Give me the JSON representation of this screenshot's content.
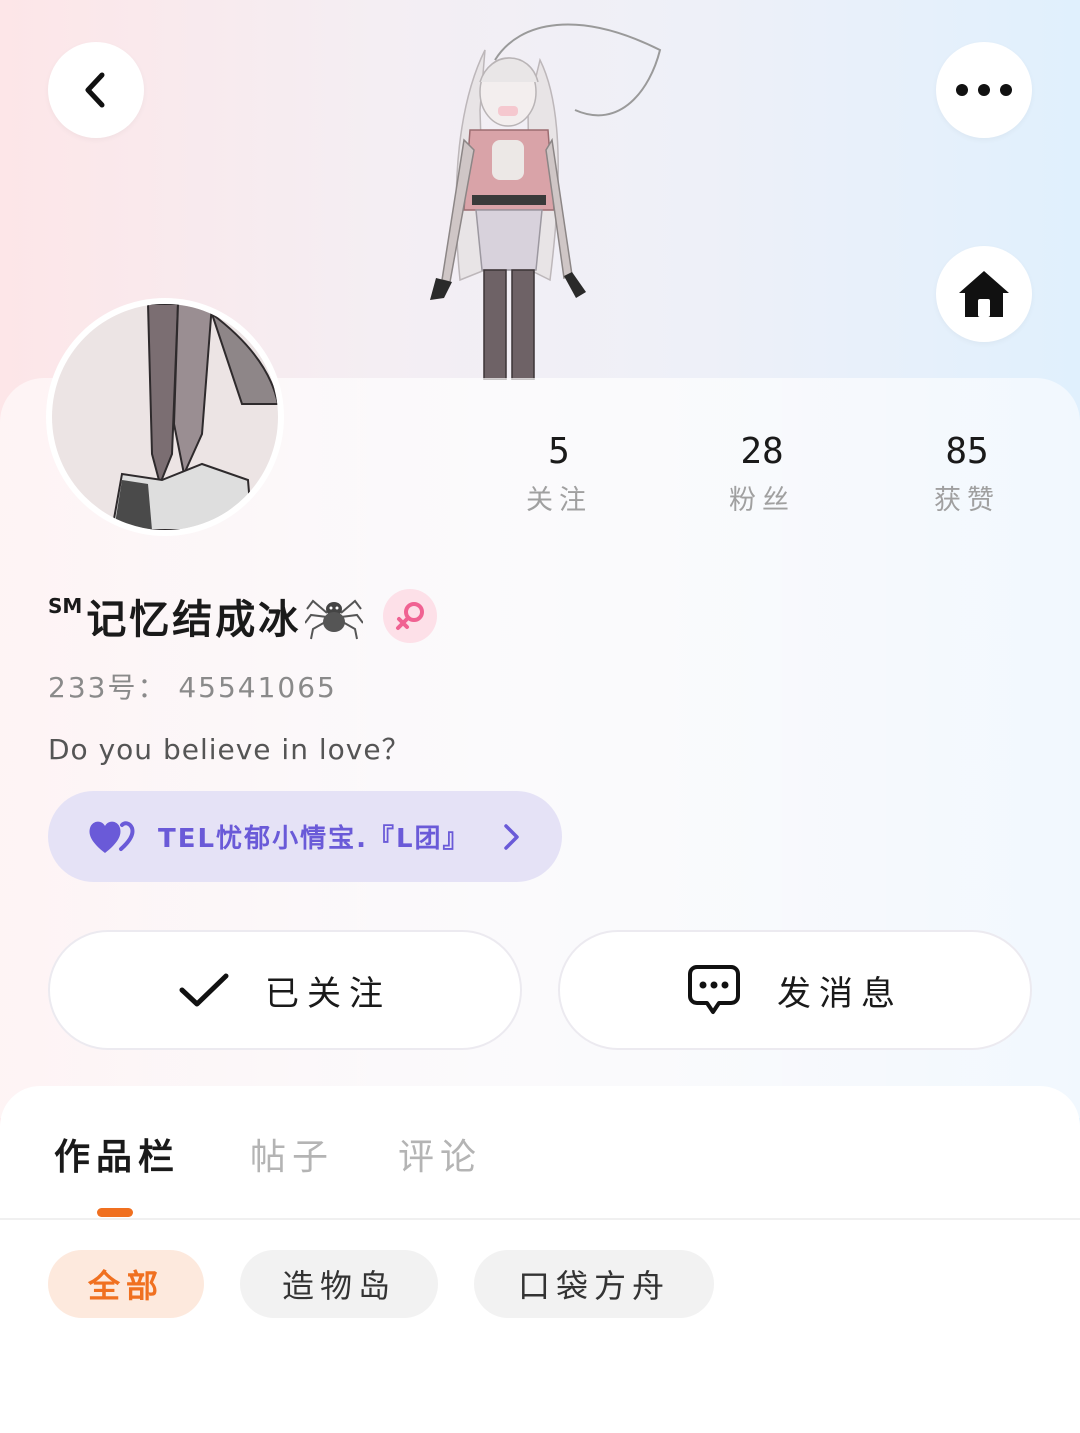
{
  "profile": {
    "name_prefix": "SM",
    "name": "记忆结成冰",
    "user_id": "233号： 45541065",
    "bio": "Do you believe in love？"
  },
  "stats": {
    "following": {
      "value": "5",
      "label": "关注"
    },
    "followers": {
      "value": "28",
      "label": "粉丝"
    },
    "likes": {
      "value": "85",
      "label": "获赞"
    }
  },
  "group": {
    "name": "TEL忧郁小情宝.『L团』"
  },
  "actions": {
    "follow_label": "已关注",
    "message_label": "发消息"
  },
  "tabs": [
    "作品栏",
    "帖子",
    "评论"
  ],
  "filters": [
    "全部",
    "造物岛",
    "口袋方舟"
  ],
  "colors": {
    "accent_orange": "#f07020",
    "group_purple": "#6a5ad8",
    "gender_pink": "#f06292"
  },
  "icons": {
    "back": "chevron-left-icon",
    "more": "more-dots-icon",
    "home": "home-icon",
    "gender": "female-icon",
    "group": "heart-icon",
    "group_arrow": "chevron-right-icon",
    "follow": "check-icon",
    "message": "chat-bubble-icon"
  }
}
